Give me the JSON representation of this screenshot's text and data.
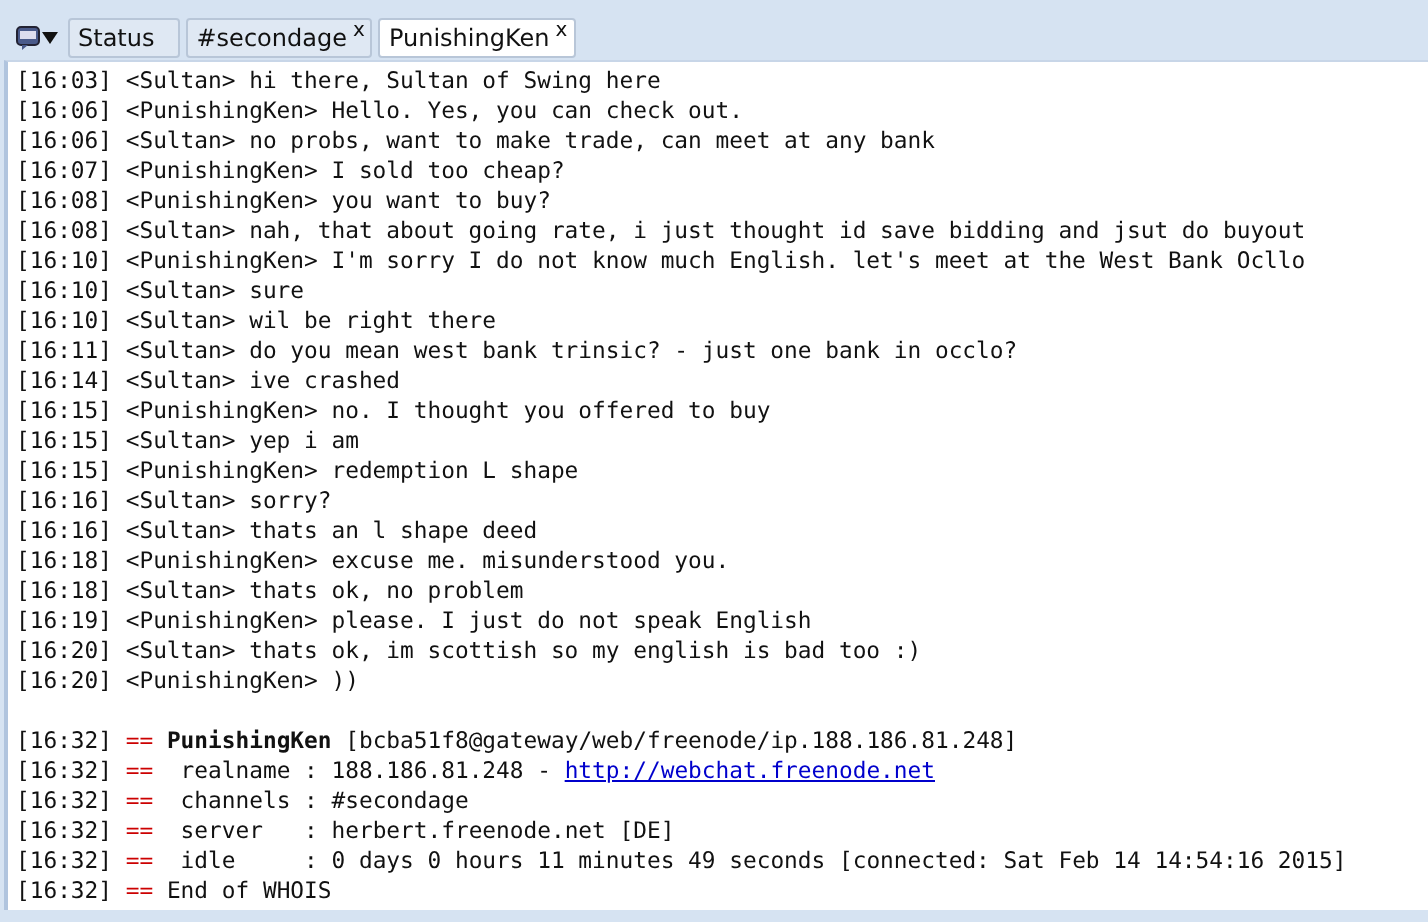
{
  "tabs": [
    {
      "label": "Status",
      "selected": false
    },
    {
      "label": "#secondage",
      "selected": false,
      "close": "x"
    },
    {
      "label": "PunishingKen",
      "selected": true,
      "close": "x"
    }
  ],
  "messages": [
    {
      "time": "[16:03]",
      "nick": "<Sultan>",
      "text": "hi there, Sultan of Swing here"
    },
    {
      "time": "[16:06]",
      "nick": "<PunishingKen>",
      "text": "Hello. Yes, you can check out."
    },
    {
      "time": "[16:06]",
      "nick": "<Sultan>",
      "text": "no probs, want to make trade, can meet at any bank"
    },
    {
      "time": "[16:07]",
      "nick": "<PunishingKen>",
      "text": "I sold too cheap?"
    },
    {
      "time": "[16:08]",
      "nick": "<PunishingKen>",
      "text": "you want to buy?"
    },
    {
      "time": "[16:08]",
      "nick": "<Sultan>",
      "text": "nah, that about going rate, i just thought id save bidding and jsut do buyout"
    },
    {
      "time": "[16:10]",
      "nick": "<PunishingKen>",
      "text": "I'm sorry I do not know much English. let's meet at the West Bank Ocllo"
    },
    {
      "time": "[16:10]",
      "nick": "<Sultan>",
      "text": "sure"
    },
    {
      "time": "[16:10]",
      "nick": "<Sultan>",
      "text": "wil be right there"
    },
    {
      "time": "[16:11]",
      "nick": "<Sultan>",
      "text": "do you mean west bank trinsic? - just one bank in occlo?"
    },
    {
      "time": "[16:14]",
      "nick": "<Sultan>",
      "text": "ive crashed"
    },
    {
      "time": "[16:15]",
      "nick": "<PunishingKen>",
      "text": "no. I thought you offered to buy"
    },
    {
      "time": "[16:15]",
      "nick": "<Sultan>",
      "text": "yep i am"
    },
    {
      "time": "[16:15]",
      "nick": "<PunishingKen>",
      "text": "redemption L shape"
    },
    {
      "time": "[16:16]",
      "nick": "<Sultan>",
      "text": "sorry?"
    },
    {
      "time": "[16:16]",
      "nick": "<Sultan>",
      "text": "thats an l shape deed"
    },
    {
      "time": "[16:18]",
      "nick": "<PunishingKen>",
      "text": "excuse me. misunderstood you."
    },
    {
      "time": "[16:18]",
      "nick": "<Sultan>",
      "text": "thats ok, no problem"
    },
    {
      "time": "[16:19]",
      "nick": "<PunishingKen>",
      "text": "please. I just do not speak English"
    },
    {
      "time": "[16:20]",
      "nick": "<Sultan>",
      "text": "thats ok, im scottish so my english is bad too :)"
    },
    {
      "time": "[16:20]",
      "nick": "<PunishingKen>",
      "text": "))"
    }
  ],
  "whois": [
    {
      "time": "[16:32]",
      "marker": "==",
      "text": "**PunishingKen** [bcba51f8@gateway/web/freenode/ip.188.186.81.248]"
    },
    {
      "time": "[16:32]",
      "marker": "==",
      "text": " realname : 188.186.81.248 - ",
      "link": "http://webchat.freenode.net"
    },
    {
      "time": "[16:32]",
      "marker": "==",
      "text": " channels : #secondage"
    },
    {
      "time": "[16:32]",
      "marker": "==",
      "text": " server   : herbert.freenode.net [DE]"
    },
    {
      "time": "[16:32]",
      "marker": "==",
      "text": " idle     : 0 days 0 hours 11 minutes 49 seconds [connected: Sat Feb 14 14:54:16 2015]"
    },
    {
      "time": "[16:32]",
      "marker": "==",
      "text": "End of WHOIS"
    }
  ]
}
